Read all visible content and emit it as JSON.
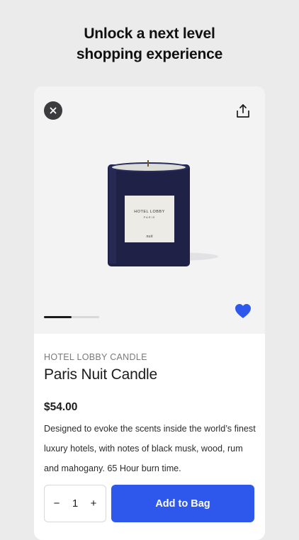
{
  "headline": {
    "line1": "Unlock a next level",
    "line2": "shopping experience"
  },
  "product": {
    "brand": "HOTEL LOBBY CANDLE",
    "name": "Paris Nuit Candle",
    "price": "$54.00",
    "description": "Designed to evoke the scents inside the world’s finest luxury hotels, with notes of black musk, wood, rum and mahogany. 65 Hour burn time.",
    "label_line1": "HOTEL LOBBY",
    "label_line2": "PARIS",
    "label_line3": "nuit",
    "gallery_progress": 0.5,
    "favorited": true
  },
  "quantity": {
    "minus": "−",
    "value": "1",
    "plus": "+"
  },
  "actions": {
    "add_to_bag": "Add to Bag"
  },
  "colors": {
    "accent": "#2e58ec",
    "heart": "#2e58ec",
    "background": "#ebebec"
  },
  "icons": {
    "close": "close-icon",
    "share": "share-icon",
    "favorite": "heart-icon"
  }
}
